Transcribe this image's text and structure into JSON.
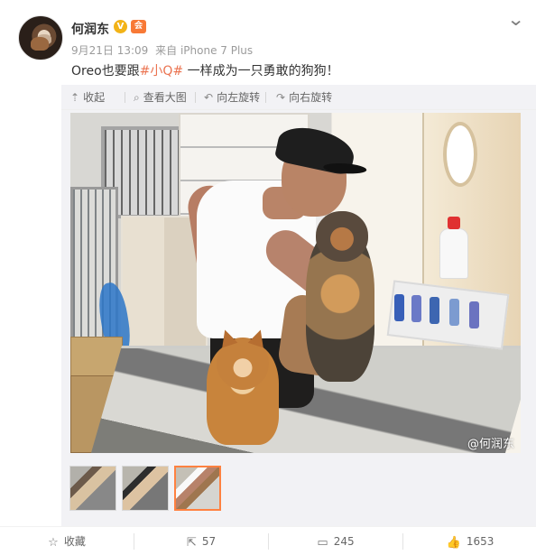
{
  "post": {
    "author": "何润东",
    "verified_badge": "V",
    "member_badge": "会",
    "time": "9月21日 13:09",
    "source": "来自 iPhone 7 Plus",
    "text_before": "Oreo也要跟",
    "topic": "#小Q#",
    "text_after": " 一样成为一只勇敢的狗狗！",
    "expand_icon": "chevron-down-icon"
  },
  "media": {
    "toolbar": {
      "collapse": "收起",
      "view_large": "查看大图",
      "rotate_left": "向左旋转",
      "rotate_right": "向右旋转"
    },
    "watermark": "@何润东",
    "thumbnails": [
      {
        "label": "thumbnail-1",
        "selected": false
      },
      {
        "label": "thumbnail-2",
        "selected": false
      },
      {
        "label": "thumbnail-3",
        "selected": true
      }
    ]
  },
  "actions": {
    "favorite": "收藏",
    "share_count": "57",
    "comment_count": "245",
    "like_count": "1653"
  },
  "colors": {
    "topic": "#eb7350",
    "verified": "#f2b317",
    "selected_thumb": "#ff8140"
  }
}
